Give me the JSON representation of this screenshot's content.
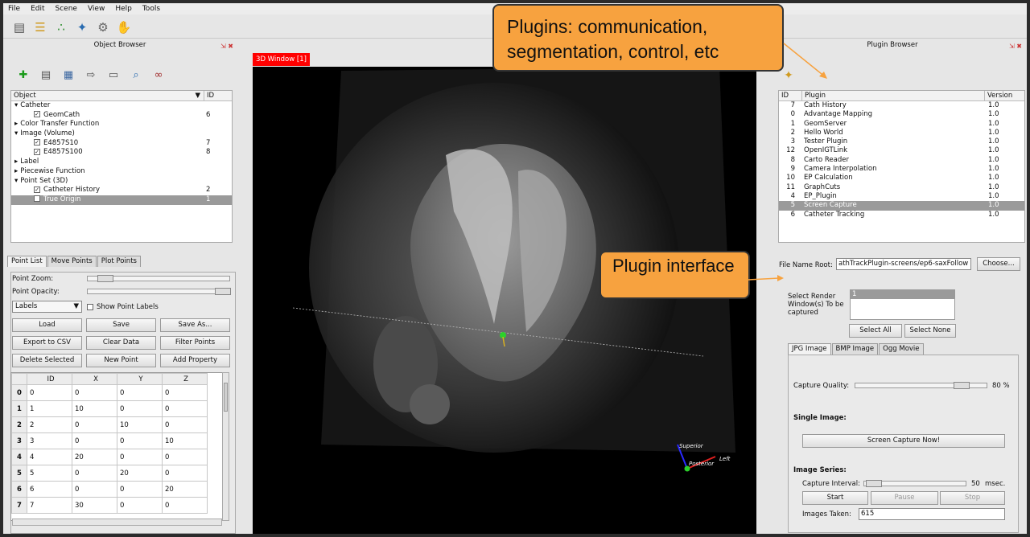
{
  "menu": [
    "File",
    "Edit",
    "Scene",
    "View",
    "Help",
    "Tools"
  ],
  "toolbar_icons": [
    "database-icon",
    "layers-icon",
    "points-icon",
    "network-icon",
    "gear-icon",
    "hands-icon"
  ],
  "object_browser": {
    "title": "Object Browser",
    "col_object": "Object",
    "col_id": "ID",
    "tool_icons": [
      "add-icon",
      "open-icon",
      "save-icon",
      "import-icon",
      "trash-icon",
      "zoom-icon",
      "link-icon"
    ],
    "rows": [
      {
        "indent": 0,
        "expander": "▾",
        "check": false,
        "label": "Catheter",
        "id": ""
      },
      {
        "indent": 1,
        "expander": "",
        "check": true,
        "label": "GeomCath",
        "id": "6"
      },
      {
        "indent": 0,
        "expander": "▸",
        "check": false,
        "label": "Color Transfer Function",
        "id": ""
      },
      {
        "indent": 0,
        "expander": "▾",
        "check": false,
        "label": "Image (Volume)",
        "id": ""
      },
      {
        "indent": 1,
        "expander": "",
        "check": true,
        "label": "E4857S10",
        "id": "7"
      },
      {
        "indent": 1,
        "expander": "",
        "check": true,
        "label": "E4857S100",
        "id": "8"
      },
      {
        "indent": 0,
        "expander": "▸",
        "check": false,
        "label": "Label",
        "id": ""
      },
      {
        "indent": 0,
        "expander": "▸",
        "check": false,
        "label": "Piecewise Function",
        "id": ""
      },
      {
        "indent": 0,
        "expander": "▾",
        "check": false,
        "label": "Point Set (3D)",
        "id": ""
      },
      {
        "indent": 1,
        "expander": "",
        "check": true,
        "label": "Catheter History",
        "id": "2"
      },
      {
        "indent": 1,
        "expander": "",
        "check": "empty",
        "label": "True Origin",
        "id": "1",
        "selected": true
      }
    ]
  },
  "point_tabs": [
    "Point List",
    "Move Points",
    "Plot Points"
  ],
  "point_panel": {
    "zoom_label": "Point Zoom:",
    "opacity_label": "Point Opacity:",
    "labels_select": "Labels",
    "show_labels": "Show Point Labels",
    "buttons": [
      "Load",
      "Save",
      "Save As...",
      "Export to CSV",
      "Clear Data",
      "Filter Points",
      "Delete Selected",
      "New Point",
      "Add Property"
    ],
    "columns": [
      "ID",
      "X",
      "Y",
      "Z"
    ],
    "rows": [
      [
        "0",
        "0",
        "0",
        "0",
        "0"
      ],
      [
        "1",
        "1",
        "10",
        "0",
        "0"
      ],
      [
        "2",
        "2",
        "0",
        "10",
        "0"
      ],
      [
        "3",
        "3",
        "0",
        "0",
        "10"
      ],
      [
        "4",
        "4",
        "20",
        "0",
        "0"
      ],
      [
        "5",
        "5",
        "0",
        "20",
        "0"
      ],
      [
        "6",
        "6",
        "0",
        "0",
        "20"
      ],
      [
        "7",
        "7",
        "30",
        "0",
        "0"
      ]
    ]
  },
  "view3d": {
    "tab": "3D Window [1]",
    "axis_superior": "Superior",
    "axis_posterior": "Posterior",
    "axis_left": "Left"
  },
  "plugin_browser": {
    "title": "Plugin Browser",
    "col_id": "ID",
    "col_plugin": "Plugin",
    "col_version": "Version",
    "rows": [
      {
        "id": "7",
        "name": "Cath History",
        "version": "1.0"
      },
      {
        "id": "0",
        "name": "Advantage Mapping",
        "version": "1.0"
      },
      {
        "id": "1",
        "name": "GeomServer",
        "version": "1.0"
      },
      {
        "id": "2",
        "name": "Hello World",
        "version": "1.0"
      },
      {
        "id": "3",
        "name": "Tester Plugin",
        "version": "1.0"
      },
      {
        "id": "12",
        "name": "OpenIGTLink",
        "version": "1.0"
      },
      {
        "id": "8",
        "name": "Carto Reader",
        "version": "1.0"
      },
      {
        "id": "9",
        "name": "Camera Interpolation",
        "version": "1.0"
      },
      {
        "id": "10",
        "name": "EP Calculation",
        "version": "1.0"
      },
      {
        "id": "11",
        "name": "GraphCuts",
        "version": "1.0"
      },
      {
        "id": "4",
        "name": "EP_Plugin",
        "version": "1.0"
      },
      {
        "id": "5",
        "name": "Screen Capture",
        "version": "1.0",
        "selected": true
      },
      {
        "id": "6",
        "name": "Catheter Tracking",
        "version": "1.0"
      }
    ]
  },
  "capture": {
    "file_root_label": "File Name Root:",
    "file_root_value": "athTrackPlugin-screens/ep6-saxFollow",
    "choose": "Choose...",
    "render_label": "Select Render Window(s) To be captured",
    "render_item": "1",
    "select_all": "Select All",
    "select_none": "Select None",
    "tabs": [
      "JPG Image",
      "BMP Image",
      "Ogg Movie"
    ],
    "quality_label": "Capture Quality:",
    "quality_value": "80 %",
    "quality": 0.8,
    "single_label": "Single Image:",
    "capture_now": "Screen Capture Now!",
    "series_label": "Image Series:",
    "interval_label": "Capture Interval:",
    "interval_value": "50",
    "interval_unit": "msec.",
    "start": "Start",
    "pause": "Pause",
    "stop": "Stop",
    "taken_label": "Images Taken:",
    "taken_value": "615"
  },
  "callouts": {
    "plugins": "Plugins: communication, segmentation, control, etc",
    "interface": "Plugin interface"
  },
  "colors": {
    "callout": "#f7a23f",
    "window_tab": "#ff0000",
    "selection": "#9a9a9a"
  }
}
